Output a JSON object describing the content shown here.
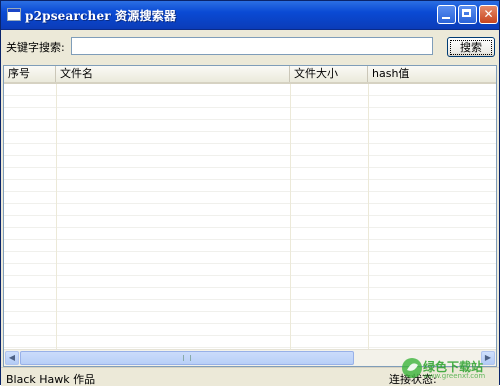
{
  "window": {
    "title": "p2psearcher 资源搜索器",
    "icon": "app-icon"
  },
  "search": {
    "label": "关键字搜索:",
    "value": "",
    "button_label": "搜索"
  },
  "table": {
    "columns": [
      "序号",
      "文件名",
      "文件大小",
      "hash值"
    ],
    "rows": []
  },
  "status": {
    "left": "Black Hawk 作品",
    "right": "连接状态:"
  },
  "watermark": {
    "text": "绿色下载站",
    "url": "www.greenxf.com"
  },
  "colors": {
    "titlebar": "#0a4ad4",
    "window_bg": "#ece9d8",
    "watermark": "#2aa12a"
  }
}
